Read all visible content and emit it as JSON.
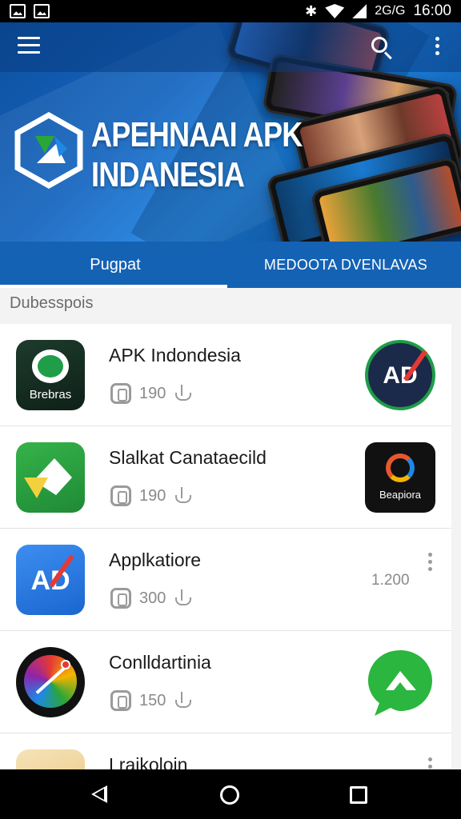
{
  "status_bar": {
    "time": "16:00",
    "network_text": "2G/G"
  },
  "header": {
    "brand_line1": "APEHNAAI APK",
    "brand_line2": "INDANESIA",
    "menu_icon": "hamburger-menu-icon",
    "search_icon": "search-icon",
    "more_icon": "more-vert-icon"
  },
  "tabs": [
    {
      "label": "Pugpat",
      "active": true
    },
    {
      "label": "MEDOOTA DVENLAVAS",
      "active": false
    }
  ],
  "section_label": "Dubesspois",
  "apps": [
    {
      "title": "APK Indondesia",
      "count": "190",
      "icon_text": "Brebras",
      "right_text": "AD"
    },
    {
      "title": "Slalkat Canataecild",
      "count": "190",
      "right_text": "Beapiora"
    },
    {
      "title": "Applkatiore",
      "count": "300",
      "icon_text": "AD",
      "right_value": "1.200"
    },
    {
      "title": "Conlldartinia",
      "count": "150"
    },
    {
      "title": "Lraikoloin"
    }
  ],
  "colors": {
    "primary": "#1462b4",
    "accent": "#1e88e5",
    "green": "#2aa639"
  }
}
